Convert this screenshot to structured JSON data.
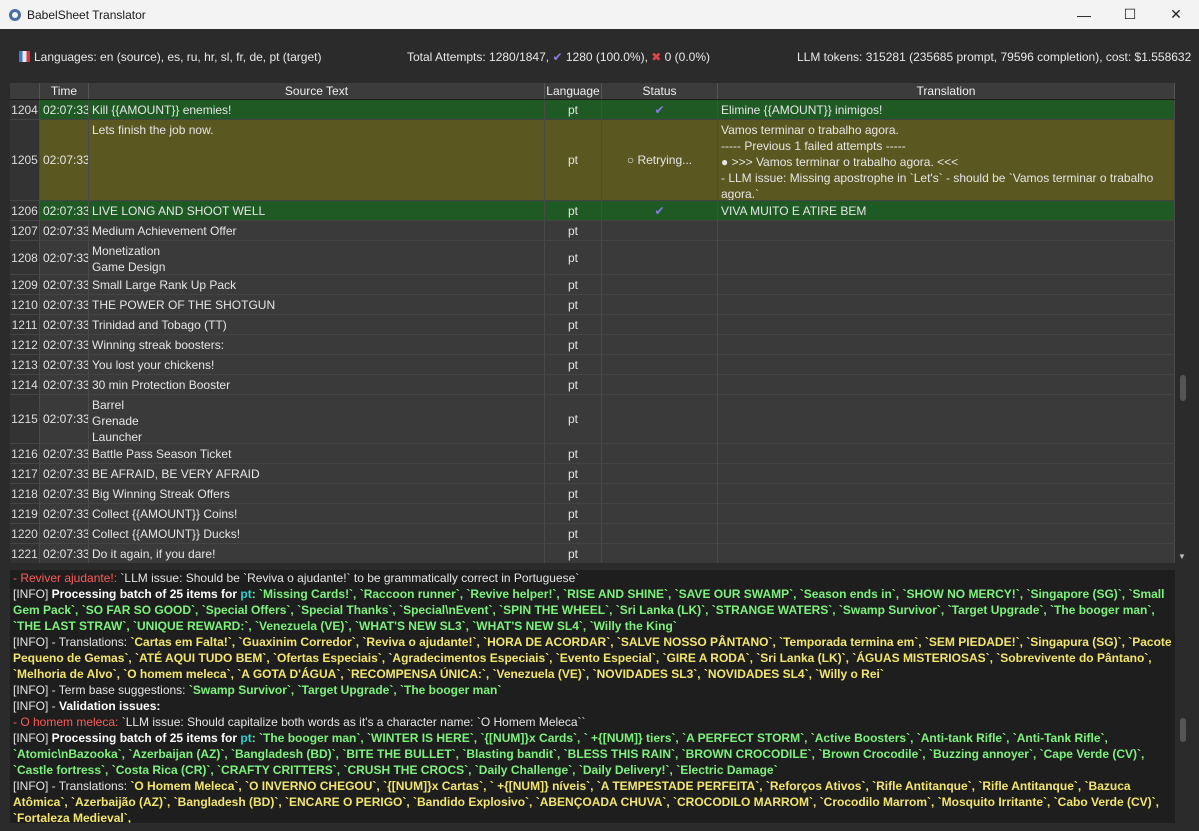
{
  "window": {
    "title": "BabelSheet Translator",
    "minimize": "—",
    "maximize": "☐",
    "close": "✕"
  },
  "stats": {
    "languages": "Languages: en (source), es, ru, hr, sl, fr, de, pt (target)",
    "attempts_prefix": "Total Attempts: 1280/1847,",
    "success": "1280 (100.0%),",
    "failed": "0 (0.0%)",
    "tokens": "LLM tokens: 315281 (235685 prompt, 79596 completion), cost: $1.558632"
  },
  "table": {
    "headers": [
      "Time",
      "Source Text",
      "Language",
      "Status",
      "Translation"
    ],
    "rows": [
      {
        "idx": "1204",
        "time": "02:07:33",
        "src": "Kill {{AMOUNT}} enemies!",
        "lang": "pt",
        "status": "✔",
        "tr": "Elimine {{AMOUNT}} inimigos!",
        "state": "ok",
        "h": 20
      },
      {
        "idx": "1205",
        "time": "02:07:33",
        "src": "Lets finish the job now.",
        "lang": "pt",
        "status": "○ Retrying...",
        "tr": "Vamos terminar o trabalho agora.\n ----- Previous 1 failed attempts -----\n● >>> Vamos terminar o trabalho agora. <<<\n    - LLM issue: Missing apostrophe in `Let's` - should be `Vamos terminar o trabalho agora.`",
        "state": "retry",
        "h": 81
      },
      {
        "idx": "1206",
        "time": "02:07:33",
        "src": "LIVE LONG AND SHOOT WELL",
        "lang": "pt",
        "status": "✔",
        "tr": "VIVA MUITO E ATIRE BEM",
        "state": "ok",
        "h": 20
      },
      {
        "idx": "1207",
        "time": "02:07:33",
        "src": "Medium Achievement Offer",
        "lang": "pt",
        "status": "",
        "tr": "",
        "state": "",
        "h": 20
      },
      {
        "idx": "1208",
        "time": "02:07:33",
        "src": "Monetization\nGame Design",
        "lang": "pt",
        "status": "",
        "tr": "",
        "state": "",
        "h": 34
      },
      {
        "idx": "1209",
        "time": "02:07:33",
        "src": "Small Large Rank Up Pack",
        "lang": "pt",
        "status": "",
        "tr": "",
        "state": "",
        "h": 20
      },
      {
        "idx": "1210",
        "time": "02:07:33",
        "src": "THE POWER OF THE SHOTGUN",
        "lang": "pt",
        "status": "",
        "tr": "",
        "state": "",
        "h": 20
      },
      {
        "idx": "1211",
        "time": "02:07:33",
        "src": "Trinidad and Tobago (TT)",
        "lang": "pt",
        "status": "",
        "tr": "",
        "state": "",
        "h": 20
      },
      {
        "idx": "1212",
        "time": "02:07:33",
        "src": "Winning streak boosters:",
        "lang": "pt",
        "status": "",
        "tr": "",
        "state": "",
        "h": 20
      },
      {
        "idx": "1213",
        "time": "02:07:33",
        "src": "You lost your chickens!",
        "lang": "pt",
        "status": "",
        "tr": "",
        "state": "",
        "h": 20
      },
      {
        "idx": "1214",
        "time": "02:07:33",
        "src": "30 min Protection Booster",
        "lang": "pt",
        "status": "",
        "tr": "",
        "state": "",
        "h": 20
      },
      {
        "idx": "1215",
        "time": "02:07:33",
        "src": "Barrel\nGrenade\nLauncher",
        "lang": "pt",
        "status": "",
        "tr": "",
        "state": "",
        "h": 49
      },
      {
        "idx": "1216",
        "time": "02:07:33",
        "src": "Battle Pass Season Ticket",
        "lang": "pt",
        "status": "",
        "tr": "",
        "state": "",
        "h": 20
      },
      {
        "idx": "1217",
        "time": "02:07:33",
        "src": "BE AFRAID, BE VERY AFRAID",
        "lang": "pt",
        "status": "",
        "tr": "",
        "state": "",
        "h": 20
      },
      {
        "idx": "1218",
        "time": "02:07:33",
        "src": "Big Winning Streak Offers",
        "lang": "pt",
        "status": "",
        "tr": "",
        "state": "",
        "h": 20
      },
      {
        "idx": "1219",
        "time": "02:07:33",
        "src": "Collect {{AMOUNT}} Coins!",
        "lang": "pt",
        "status": "",
        "tr": "",
        "state": "",
        "h": 20
      },
      {
        "idx": "1220",
        "time": "02:07:33",
        "src": "Collect {{AMOUNT}} Ducks!",
        "lang": "pt",
        "status": "",
        "tr": "",
        "state": "",
        "h": 20
      },
      {
        "idx": "1221",
        "time": "02:07:33",
        "src": "Do it again, if you dare!",
        "lang": "pt",
        "status": "",
        "tr": "",
        "state": "",
        "h": 20
      }
    ]
  },
  "log": {
    "l1_red": "- Reviver ajudante!:",
    "l1_rest": " `LLM issue: Should be `Reviva o ajudante!` to be grammatically correct in Portuguese`",
    "l2_prefix": "[INFO] ",
    "l2_bold": "Processing batch of 25 items for ",
    "l2_lang": "pt",
    "l2_items": ": `Missing Cards!`, `Raccoon runner`, `Revive helper!`, `RISE AND SHINE`, `SAVE OUR SWAMP`, `Season ends in`, `SHOW NO MERCY!`, `Singapore (SG)`, `Small Gem Pack`, `SO FAR SO GOOD`, `Special Offers`, `Special Thanks`, `Special\\nEvent`, `SPIN THE WHEEL`, `Sri Lanka (LK)`, `STRANGE WATERS`, `Swamp Survivor`, `Target Upgrade`, `The booger man`, `THE LAST STRAW`, `UNIQUE REWARD:`, `Venezuela (VE)`, `WHAT'S NEW SL3`, `WHAT'S NEW SL4`, `Willy the King`",
    "l3_prefix": "[INFO] - Translations: ",
    "l3_items": "`Cartas em Falta!`, `Guaxinim Corredor`, `Reviva o ajudante!`, `HORA DE ACORDAR`, `SALVE NOSSO PÂNTANO`, `Temporada termina em`, `SEM PIEDADE!`, `Singapura (SG)`, `Pacote Pequeno de Gemas`, `ATÉ AQUI TUDO BEM`, `Ofertas Especiais`, `Agradecimentos Especiais`, `Evento Especial`, `GIRE A RODA`, `Sri Lanka (LK)`, `ÁGUAS MISTERIOSAS`, `Sobrevivente do Pântano`, `Melhoria de Alvo`, `O homem meleca`, `A GOTA D'ÁGUA`, `RECOMPENSA ÚNICA:`, `Venezuela (VE)`, `NOVIDADES SL3`, `NOVIDADES SL4`, `Willy o Rei`",
    "l4_prefix": "[INFO] - Term base suggestions: ",
    "l4_items": "`Swamp Survivor`, `Target Upgrade`, `The booger man`",
    "l5_prefix": "[INFO] - ",
    "l5_bold": "Validation issues:",
    "l6_red": "- O homem meleca:",
    "l6_rest": " `LLM issue: Should capitalize both words as it's a character name: `O Homem Meleca``",
    "l7_prefix": "[INFO] ",
    "l7_bold": "Processing batch of 25 items for ",
    "l7_lang": "pt",
    "l7_items": ": `The booger man`, `WINTER IS HERE`, `{[NUM]}x Cards`, ` +{[NUM]} tiers`, `A PERFECT STORM`, `Active Boosters`, `Anti-tank Rifle`, `Anti-Tank Rifle`, `Atomic\\nBazooka`, `Azerbaijan (AZ)`, `Bangladesh (BD)`, `BITE THE BULLET`, `Blasting bandit`, `BLESS THIS RAIN`, `BROWN CROCODILE`, `Brown Crocodile`, `Buzzing annoyer`, `Cape Verde (CV)`, `Castle fortress`, `Costa Rica (CR)`, `CRAFTY CRITTERS`, `CRUSH THE CROCS`, `Daily Challenge`, `Daily Delivery!`, `Electric Damage`",
    "l8_prefix": "[INFO] - Translations: ",
    "l8_items": "`O Homem Meleca`, `O INVERNO CHEGOU`, `{[NUM]}x Cartas`, ` +{[NUM]} níveis`, `A TEMPESTADE PERFEITA`, `Reforços Ativos`, `Rifle Antitanque`, `Rifle Antitanque`, `Bazuca Atômica`, `Azerbaijão (AZ)`, `Bangladesh (BD)`, `ENCARE O PERIGO`, `Bandido Explosivo`, `ABENÇOADA CHUVA`, `CROCODILO MARROM`, `Crocodilo Marrom`, `Mosquito Irritante`, `Cabo Verde (CV)`, `Fortaleza Medieval`,"
  }
}
